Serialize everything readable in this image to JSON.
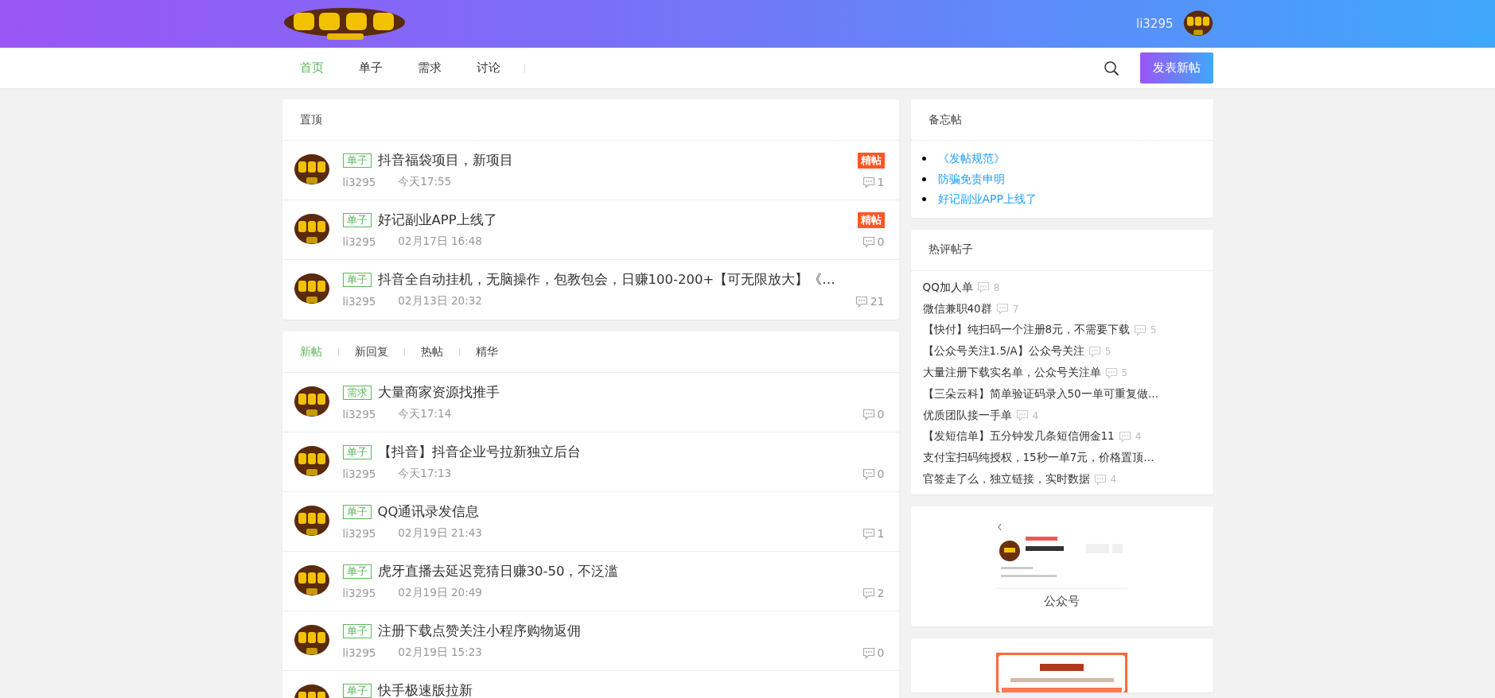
{
  "header": {
    "username": "li3295"
  },
  "nav": {
    "items": [
      {
        "label": "首页",
        "selected": true
      },
      {
        "label": "单子",
        "selected": false
      },
      {
        "label": "需求",
        "selected": false
      },
      {
        "label": "讨论",
        "selected": false
      }
    ],
    "post_button": "发表新帖"
  },
  "pinned": {
    "title": "置顶",
    "posts": [
      {
        "tag": "单子",
        "title": "抖音福袋项目，新项目",
        "author": "li3295",
        "time": "今天17:55",
        "comments": "1",
        "badge": "精帖"
      },
      {
        "tag": "单子",
        "title": "好记副业APP上线了",
        "author": "li3295",
        "time": "02月17日 16:48",
        "comments": "0",
        "badge": "精帖"
      },
      {
        "tag": "单子",
        "title": "抖音全自动挂机，无脑操作，包教包会，日赚100-200+【可无限放大】《…",
        "author": "li3295",
        "time": "02月13日 20:32",
        "comments": "21"
      }
    ]
  },
  "feed": {
    "tabs": [
      {
        "label": "新帖",
        "selected": true
      },
      {
        "label": "新回复",
        "selected": false
      },
      {
        "label": "热帖",
        "selected": false
      },
      {
        "label": "精华",
        "selected": false
      }
    ],
    "posts": [
      {
        "tag": "需求",
        "title": "大量商家资源找推手",
        "author": "li3295",
        "time": "今天17:14",
        "comments": "0"
      },
      {
        "tag": "单子",
        "title": "【抖音】抖音企业号拉新独立后台",
        "author": "li3295",
        "time": "今天17:13",
        "comments": "0"
      },
      {
        "tag": "单子",
        "title": "QQ通讯录发信息",
        "author": "li3295",
        "time": "02月19日 21:43",
        "comments": "1"
      },
      {
        "tag": "单子",
        "title": "虎牙直播去延迟竞猜日赚30-50，不泛滥",
        "author": "li3295",
        "time": "02月19日 20:49",
        "comments": "2"
      },
      {
        "tag": "单子",
        "title": "注册下载点赞关注小程序购物返佣",
        "author": "li3295",
        "time": "02月19日 15:23",
        "comments": "0"
      },
      {
        "tag": "单子",
        "title": "快手极速版拉新"
      }
    ]
  },
  "notice": {
    "title": "备忘帖",
    "links": [
      "《发帖规范》",
      "防骗免责申明",
      "好记副业APP上线了"
    ]
  },
  "hot": {
    "title": "热评帖子",
    "items": [
      {
        "title": "QQ加人单",
        "comments": "8"
      },
      {
        "title": "微信兼职40群",
        "comments": "7"
      },
      {
        "title": "【快付】纯扫码一个注册8元，不需要下载",
        "comments": "5"
      },
      {
        "title": "【公众号关注1.5/A】公众号关注",
        "comments": "5"
      },
      {
        "title": "大量注册下载实名单，公众号关注单",
        "comments": "5"
      },
      {
        "title": "【三朵云科】简单验证码录入50一单可重复做…"
      },
      {
        "title": "优质团队接一手单",
        "comments": "4"
      },
      {
        "title": "【发短信单】五分钟发几条短信佣金11",
        "comments": "4"
      },
      {
        "title": "支付宝扫码纯授权，15秒一单7元，价格置顶…"
      },
      {
        "title": "官签走了么，独立链接，实时数据",
        "comments": "4"
      }
    ]
  },
  "qr_card": {
    "caption": "公众号"
  }
}
